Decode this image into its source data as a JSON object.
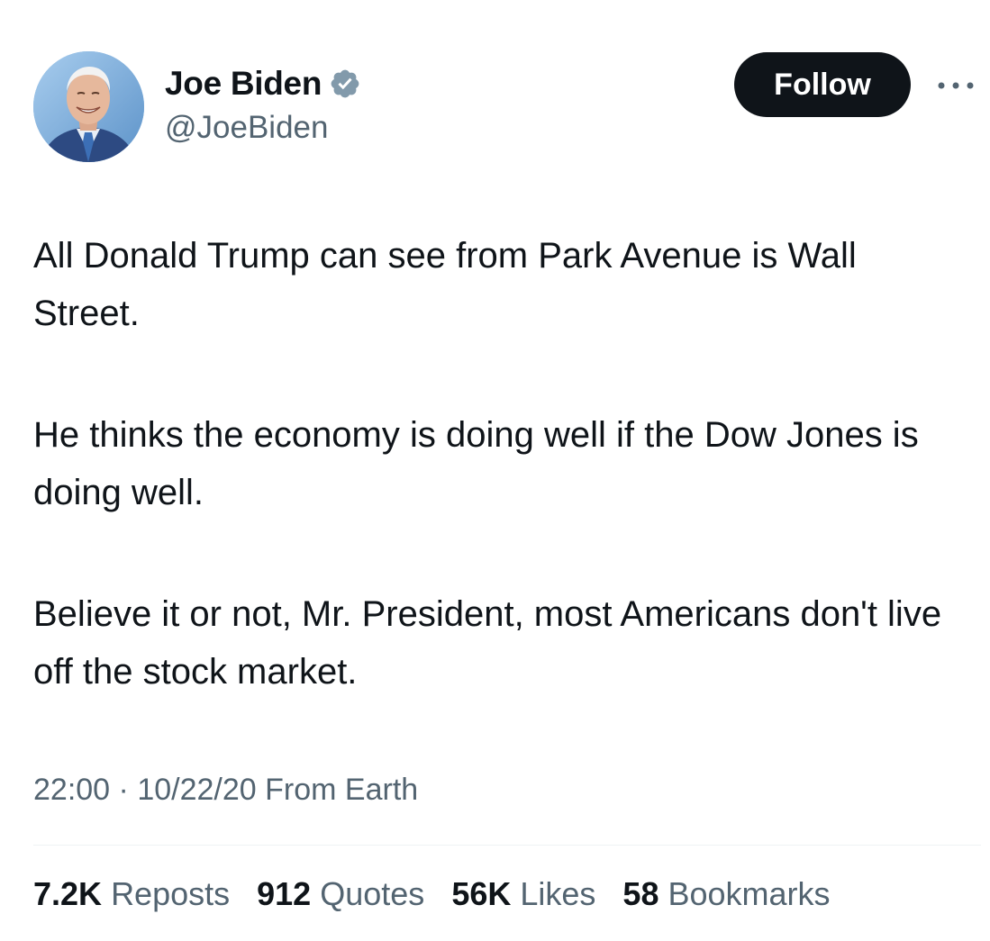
{
  "author": {
    "name": "Joe Biden",
    "handle": "@JoeBiden",
    "verified_icon": "verified-badge-icon",
    "verified_color": "#829aab"
  },
  "actions": {
    "follow_label": "Follow",
    "more_icon": "more-options-icon"
  },
  "tweet": {
    "paragraphs": [
      "All Donald Trump can see from Park Avenue is Wall Street.",
      "He thinks the economy is doing well if the Dow Jones is doing well.",
      "Believe it or not, Mr. President, most Americans don't live off the stock market."
    ],
    "time": "22:00",
    "separator": "·",
    "date": "10/22/20",
    "source": "From Earth"
  },
  "stats": {
    "reposts": {
      "value": "7.2K",
      "label": "Reposts"
    },
    "quotes": {
      "value": "912",
      "label": "Quotes"
    },
    "likes": {
      "value": "56K",
      "label": "Likes"
    },
    "bookmarks": {
      "value": "58",
      "label": "Bookmarks"
    }
  },
  "colors": {
    "text_primary": "#0f1419",
    "text_secondary": "#536471",
    "follow_button_bg": "#0f1419",
    "divider": "#eff3f4"
  }
}
